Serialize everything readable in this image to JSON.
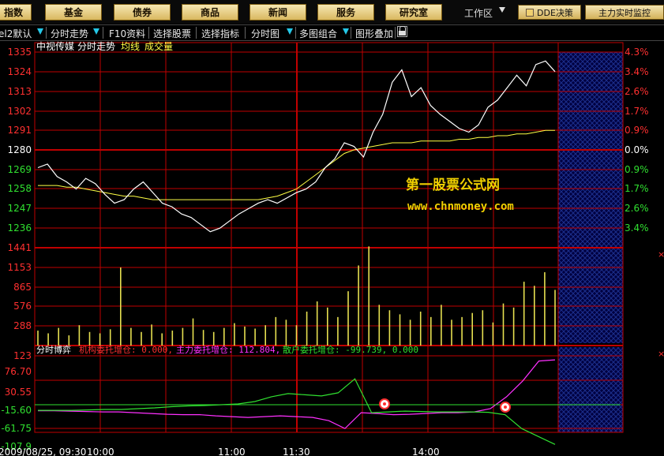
{
  "toolbar": {
    "buttons": [
      "指数",
      "基金",
      "债券",
      "商品",
      "新闻",
      "服务",
      "研究室"
    ],
    "workarea_label": "工作区",
    "dde_label": "DDE决策",
    "monitor_label": "主力实时监控"
  },
  "menu": {
    "items": [
      {
        "label": "el2默认",
        "dropdown": true
      },
      {
        "label": "分时走势",
        "dropdown": true
      },
      {
        "label": "F10资料",
        "dropdown": false
      },
      {
        "label": "选择股票",
        "dropdown": false
      },
      {
        "label": "选择指标",
        "dropdown": false
      },
      {
        "label": "分时图",
        "dropdown": true
      },
      {
        "label": "多图组合",
        "dropdown": true
      },
      {
        "label": "图形叠加",
        "dropdown": false
      }
    ]
  },
  "price_panel": {
    "stock_name": "中视传媒",
    "chart_name": "分时走势",
    "avg_label": "均线",
    "vol_label": "成交量",
    "y_labels_left": [
      "1335",
      "1324",
      "1313",
      "1302",
      "1291",
      "1280",
      "1269",
      "1258",
      "1247",
      "1236"
    ],
    "y_labels_right": [
      "4.3%",
      "3.4%",
      "2.6%",
      "1.7%",
      "0.9%",
      "0.0%",
      "0.9%",
      "1.7%",
      "2.6%",
      "3.4%"
    ],
    "watermark_title": "第一股票公式网",
    "watermark_url": "www.chnmoney.com"
  },
  "volume_panel": {
    "y_labels": [
      "1441",
      "1153",
      "865",
      "576",
      "288"
    ]
  },
  "indicator_panel": {
    "name": "分时博弈",
    "inst_label": "机构委托增仓: 0.000,",
    "main_label": "主力委托增仓: 112.804,",
    "retail_label": "散户委托增仓: -99.739, 0.000",
    "y_labels": [
      "123",
      "76.70",
      "30.55",
      "-15.60",
      "-61.75",
      "-107.9"
    ]
  },
  "time_axis": {
    "labels": [
      "2009/08/25, 09:30",
      "10:00",
      "11:00",
      "11:30",
      "14:00"
    ]
  },
  "colors": {
    "price_line": "#ffffff",
    "avg_line": "#ffff44",
    "grid": "#c00000",
    "volume": "#e6e050",
    "main_force": "#ff30ff",
    "retail": "#30e030",
    "axis_up": "#ff3030",
    "axis_down": "#30e030"
  },
  "chart_data": [
    {
      "type": "line",
      "series": [
        {
          "name": "分时走势",
          "values": [
            1270,
            1272,
            1265,
            1262,
            1258,
            1264,
            1261,
            1255,
            1250,
            1252,
            1258,
            1262,
            1256,
            1250,
            1248,
            1244,
            1242,
            1238,
            1234,
            1236,
            1240,
            1244,
            1247,
            1250,
            1252,
            1250,
            1253,
            1256,
            1258,
            1262,
            1270,
            1275,
            1284,
            1282,
            1276,
            1290,
            1300,
            1318,
            1325,
            1310,
            1315,
            1305,
            1300,
            1296,
            1292,
            1290,
            1294,
            1304,
            1308,
            1315,
            1322,
            1316,
            1328,
            1330,
            1324
          ]
        },
        {
          "name": "均线",
          "values": [
            1260,
            1260,
            1260,
            1259,
            1259,
            1258,
            1257,
            1256,
            1255,
            1254,
            1254,
            1253,
            1252,
            1252,
            1252,
            1252,
            1252,
            1252,
            1252,
            1252,
            1252,
            1252,
            1252,
            1252,
            1253,
            1254,
            1256,
            1258,
            1262,
            1266,
            1270,
            1274,
            1278,
            1280,
            1281,
            1282,
            1283,
            1284,
            1284,
            1284,
            1285,
            1285,
            1285,
            1285,
            1286,
            1286,
            1287,
            1287,
            1288,
            1288,
            1289,
            1289,
            1290,
            1291,
            1291
          ]
        }
      ],
      "ylim": [
        1230,
        1340
      ]
    },
    {
      "type": "bar",
      "values": [
        220,
        180,
        260,
        150,
        300,
        200,
        180,
        240,
        1150,
        260,
        200,
        310,
        180,
        220,
        260,
        400,
        230,
        200,
        260,
        330,
        280,
        250,
        300,
        420,
        380,
        300,
        500,
        650,
        560,
        420,
        800,
        1180,
        1460,
        600,
        520,
        460,
        380,
        500,
        420,
        600,
        380,
        420,
        480,
        520,
        340,
        620,
        560,
        940,
        880,
        1080,
        820
      ],
      "ylim": [
        0,
        1441
      ]
    },
    {
      "type": "line",
      "series": [
        {
          "name": "主力委托增仓",
          "values": [
            -15,
            -15,
            -16,
            -17,
            -18,
            -18,
            -20,
            -22,
            -24,
            -25,
            -25,
            -28,
            -30,
            -32,
            -30,
            -28,
            -30,
            -32,
            -40,
            -60,
            -20,
            -22,
            -25,
            -24,
            -22,
            -20,
            -20,
            -18,
            -10,
            20,
            60,
            110,
            112.804
          ]
        },
        {
          "name": "散户委托增仓",
          "values": [
            -14,
            -14,
            -14,
            -13,
            -12,
            -12,
            -10,
            -8,
            -5,
            -3,
            -2,
            0,
            2,
            8,
            20,
            28,
            25,
            22,
            30,
            65,
            -20,
            -18,
            -16,
            -17,
            -18,
            -18,
            -18,
            -19,
            -25,
            -60,
            -80,
            -99.739
          ]
        }
      ],
      "ylim": [
        -107.9,
        123
      ]
    }
  ]
}
